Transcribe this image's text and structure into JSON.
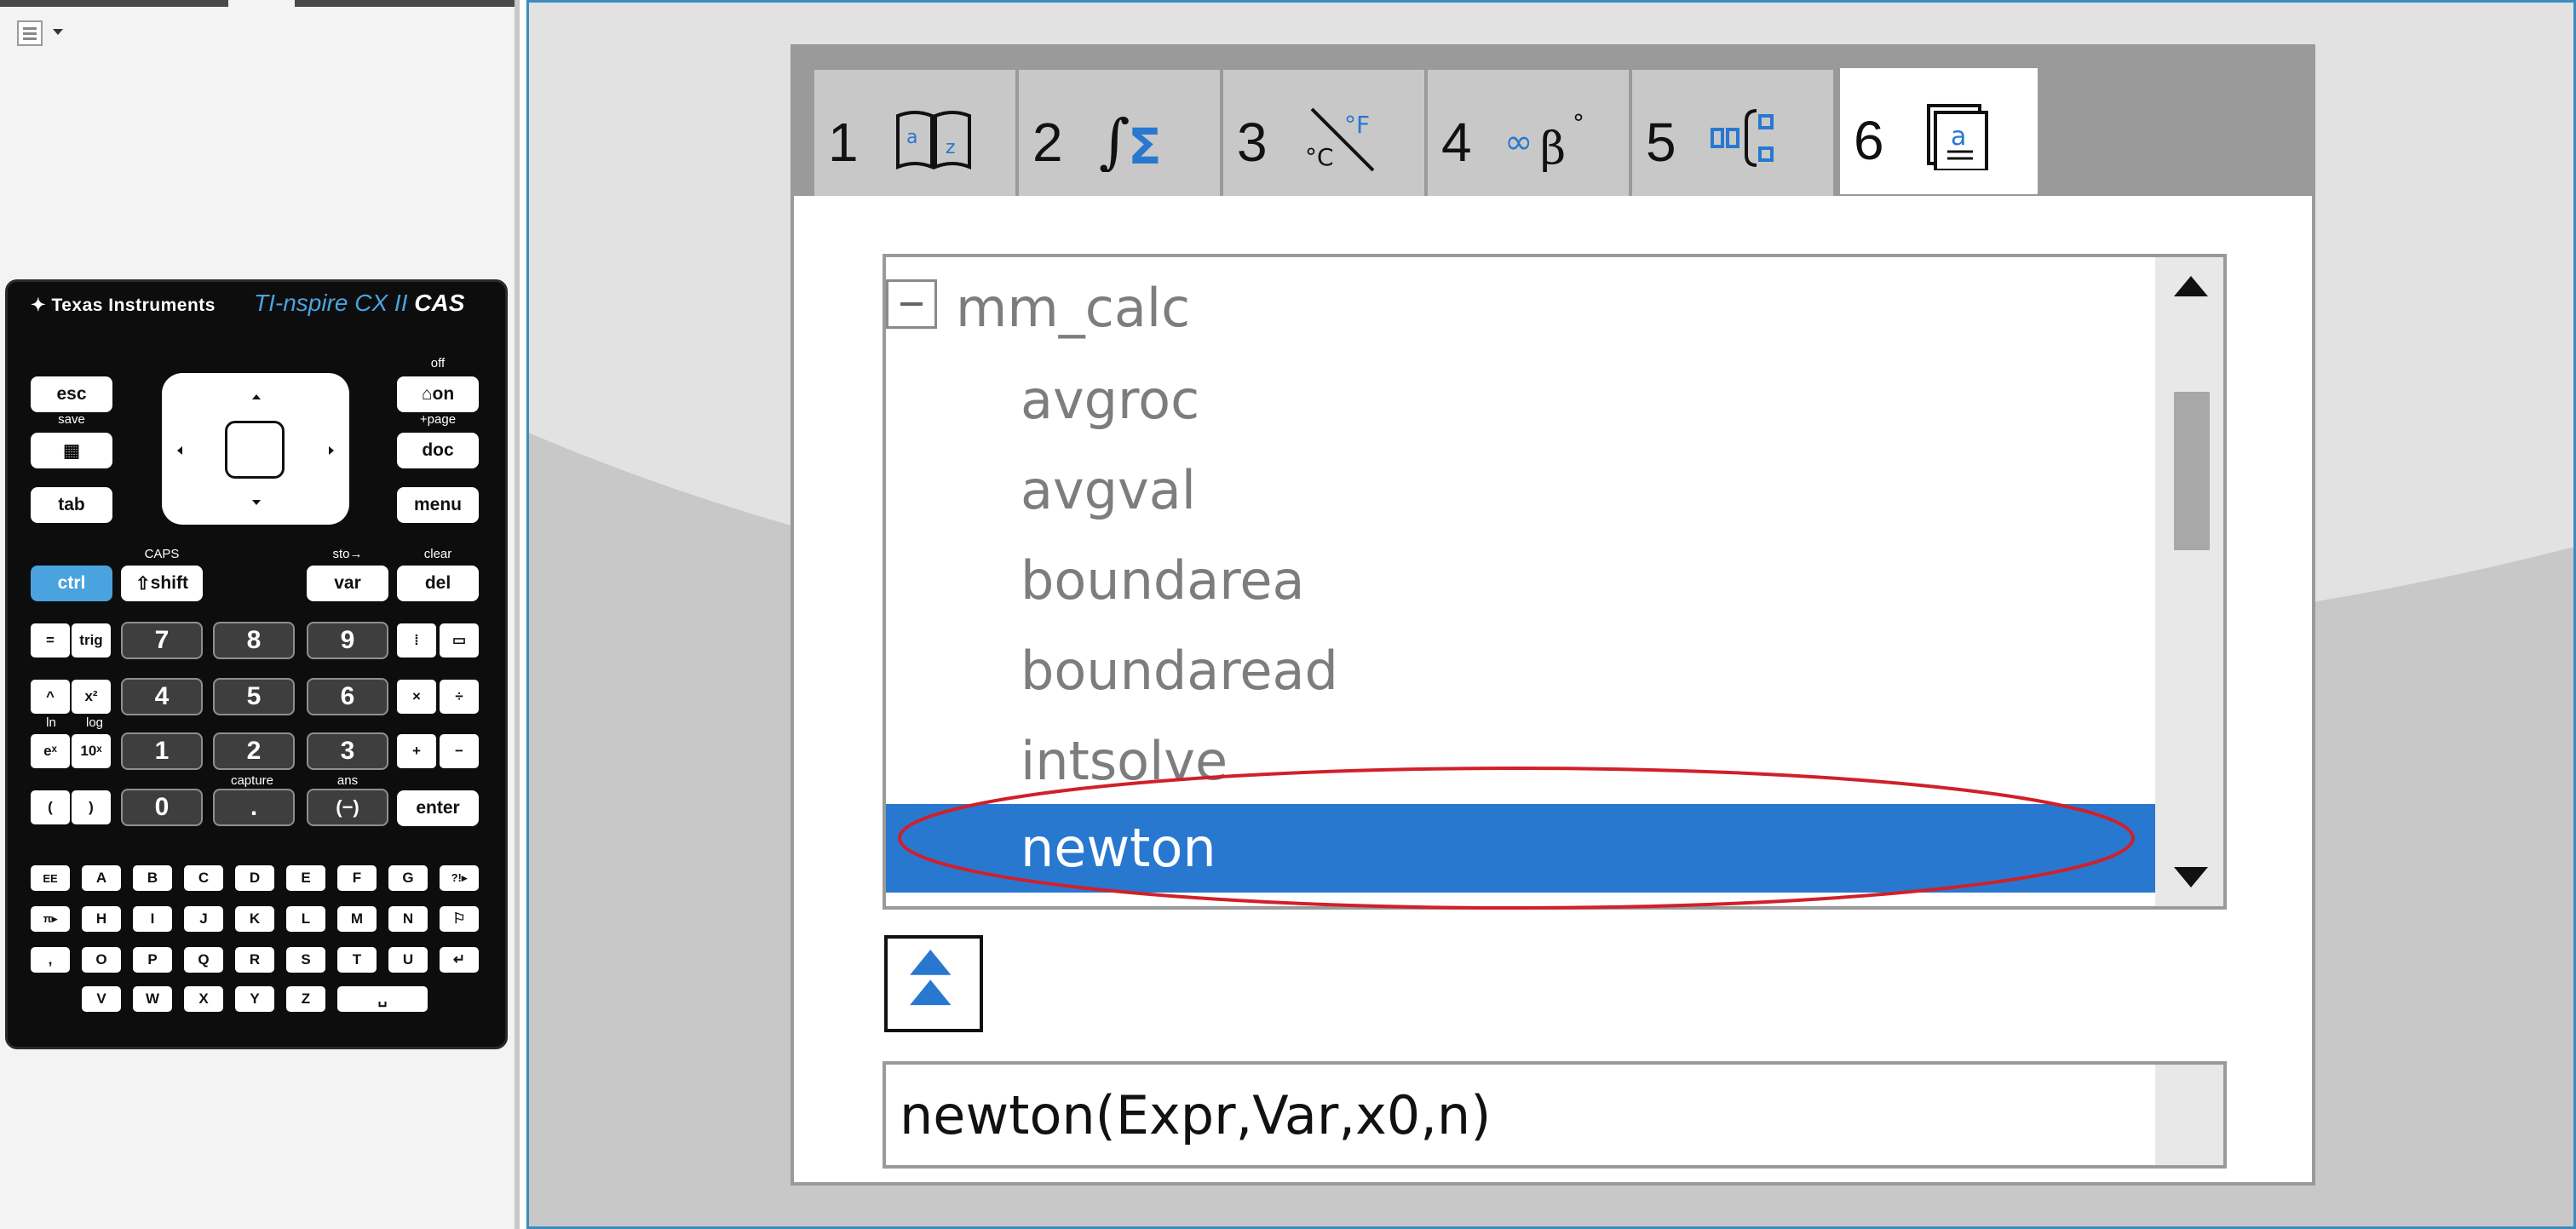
{
  "calculator": {
    "brand": "Texas Instruments",
    "model": "TI-nspire CX II",
    "model_suffix": "CAS",
    "keys": {
      "esc": "esc",
      "on": "on",
      "doc": "doc",
      "menu": "menu",
      "tab": "tab",
      "ctrl": "ctrl",
      "shift": "shift",
      "var": "var",
      "del": "del",
      "eq": "=",
      "trig": "trig",
      "n7": "7",
      "n8": "8",
      "n9": "9",
      "caret": "^",
      "x2": "x²",
      "n4": "4",
      "n5": "5",
      "n6": "6",
      "times": "×",
      "div": "÷",
      "ex": "eˣ",
      "tenx": "10ˣ",
      "n1": "1",
      "n2": "2",
      "n3": "3",
      "plus": "+",
      "minus": "−",
      "lparen": "(",
      "rparen": ")",
      "n0": "0",
      "dot": ".",
      "neg": "(−)",
      "enter": "enter",
      "ee": "EE",
      "A": "A",
      "B": "B",
      "C": "C",
      "D": "D",
      "E": "E",
      "F": "F",
      "G": "G",
      "punct": "?!▸",
      "pi": "π▸",
      "H": "H",
      "I": "I",
      "J": "J",
      "K": "K",
      "L": "L",
      "M": "M",
      "N": "N",
      "flag": "⚐",
      "comma": ",",
      "O": "O",
      "P": "P",
      "Q": "Q",
      "R": "R",
      "S": "S",
      "T": "T",
      "U": "U",
      "ret": "↵",
      "V": "V",
      "W": "W",
      "X": "X",
      "Y": "Y",
      "Z": "Z",
      "space": "␣"
    },
    "labels": {
      "off": "off",
      "save": "save",
      "page": "+page",
      "caps": "CAPS",
      "sto": "sto→",
      "clear": "clear",
      "capture": "capture",
      "ans": "ans",
      "log": "log",
      "ln": "ln"
    }
  },
  "tabs": [
    {
      "number": "1",
      "icon": "book-catalog-icon"
    },
    {
      "number": "2",
      "icon": "math-templates-icon"
    },
    {
      "number": "3",
      "icon": "units-icon"
    },
    {
      "number": "4",
      "icon": "symbols-icon"
    },
    {
      "number": "5",
      "icon": "library-icon"
    },
    {
      "number": "6",
      "icon": "user-library-icon"
    }
  ],
  "tree": {
    "folder": "mm_calc",
    "items": [
      "avgroc",
      "avgval",
      "boundarea",
      "boundaread",
      "intsolve",
      "newton"
    ],
    "selected": "newton"
  },
  "syntax": "newton(Expr,Var,x0,n)",
  "colors": {
    "selection": "#2878d0",
    "highlight_ring": "#d0202a",
    "accent": "#4aa3df"
  }
}
